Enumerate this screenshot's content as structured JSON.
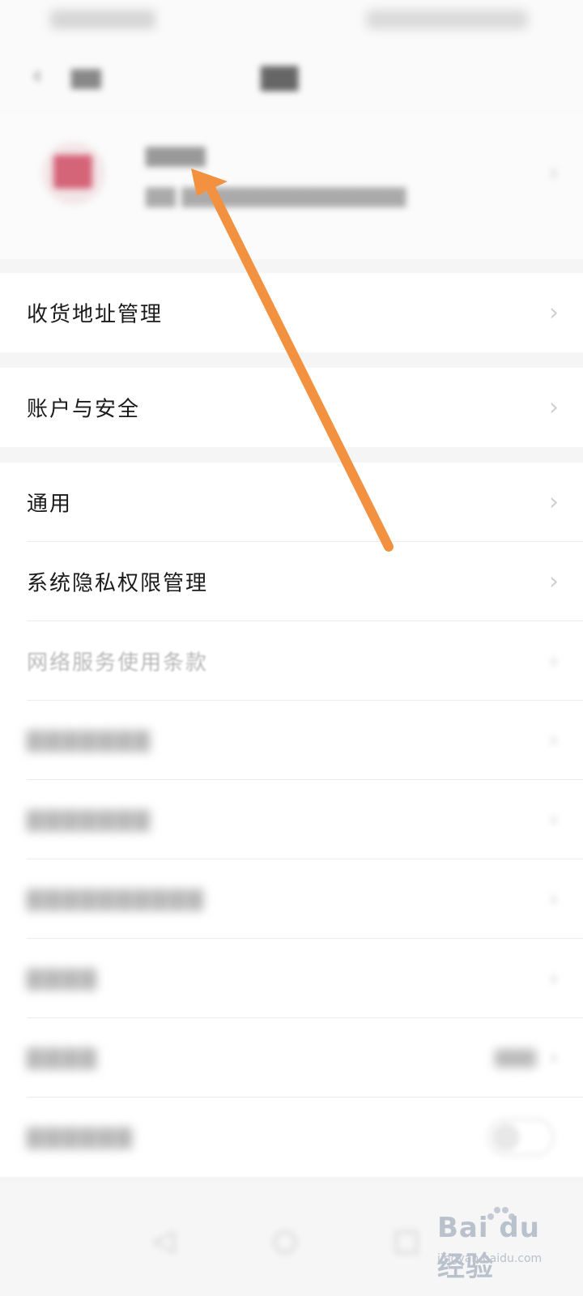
{
  "status_bar": {},
  "header": {
    "back_icon": "chevron-left-icon"
  },
  "profile": {},
  "sections": [
    {
      "label": "收货地址管理"
    },
    {
      "label": "账户与安全"
    },
    {
      "label": "通用"
    },
    {
      "label": "系统隐私权限管理"
    },
    {
      "label": "网络服务使用条款"
    }
  ],
  "annotation": {
    "arrow_color": "#f29240"
  },
  "watermark": {
    "brand": "Bai du 经验",
    "url": "jingyan.baidu.com"
  },
  "colors": {
    "background": "#f5f5f5",
    "row": "#ffffff",
    "text": "#1a1a1a",
    "arrow": "#f29240"
  }
}
